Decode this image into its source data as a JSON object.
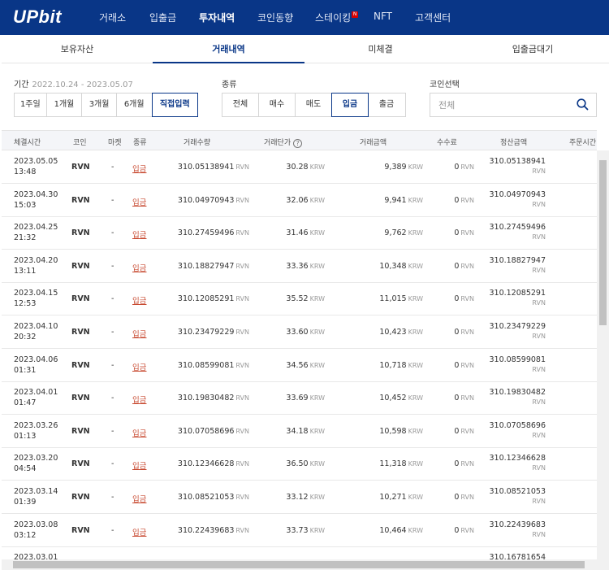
{
  "brand": {
    "logo": "UPbit"
  },
  "nav": {
    "items": [
      "거래소",
      "입출금",
      "투자내역",
      "코인동향",
      "스테이킹",
      "NFT",
      "고객센터"
    ],
    "active": "투자내역",
    "new_badge": "N",
    "colors": {
      "bar": "#093687",
      "badge": "#d60000"
    }
  },
  "subtabs": [
    "보유자산",
    "거래내역",
    "미체결",
    "입출금대기"
  ],
  "subtab_active": "거래내역",
  "filter": {
    "period_label": "기간",
    "date_range": "2022.10.24 - 2023.05.07",
    "periods": [
      "1주일",
      "1개월",
      "3개월",
      "6개월",
      "직접입력"
    ],
    "period_selected": "직접입력",
    "kind_label": "종류",
    "kinds": [
      "전체",
      "매수",
      "매도",
      "입금",
      "출금"
    ],
    "kind_selected": "입금",
    "coin_label": "코인선택",
    "search_placeholder": "전체",
    "search_icon": "search-icon"
  },
  "table": {
    "headers": [
      "체결시간",
      "코인",
      "마켓",
      "종류",
      "거래수량",
      "거래단가",
      "거래금액",
      "수수료",
      "정산금액",
      "주문시간"
    ],
    "help_mark": "?",
    "rows": [
      {
        "date": "2023.05.05",
        "time": "13:48",
        "coin": "RVN",
        "market": "-",
        "kind": "입금",
        "qty": "310.05138941",
        "qty_unit": "RVN",
        "price": "30.28",
        "price_unit": "KRW",
        "amount": "9,389",
        "amount_unit": "KRW",
        "fee": "0",
        "fee_unit": "RVN",
        "settle": "310.05138941",
        "settle_unit": "RVN",
        "order_time": "-"
      },
      {
        "date": "2023.04.30",
        "time": "15:03",
        "coin": "RVN",
        "market": "-",
        "kind": "입금",
        "qty": "310.04970943",
        "qty_unit": "RVN",
        "price": "32.06",
        "price_unit": "KRW",
        "amount": "9,941",
        "amount_unit": "KRW",
        "fee": "0",
        "fee_unit": "RVN",
        "settle": "310.04970943",
        "settle_unit": "RVN",
        "order_time": "-"
      },
      {
        "date": "2023.04.25",
        "time": "21:32",
        "coin": "RVN",
        "market": "-",
        "kind": "입금",
        "qty": "310.27459496",
        "qty_unit": "RVN",
        "price": "31.46",
        "price_unit": "KRW",
        "amount": "9,762",
        "amount_unit": "KRW",
        "fee": "0",
        "fee_unit": "RVN",
        "settle": "310.27459496",
        "settle_unit": "RVN",
        "order_time": "-"
      },
      {
        "date": "2023.04.20",
        "time": "13:11",
        "coin": "RVN",
        "market": "-",
        "kind": "입금",
        "qty": "310.18827947",
        "qty_unit": "RVN",
        "price": "33.36",
        "price_unit": "KRW",
        "amount": "10,348",
        "amount_unit": "KRW",
        "fee": "0",
        "fee_unit": "RVN",
        "settle": "310.18827947",
        "settle_unit": "RVN",
        "order_time": "-"
      },
      {
        "date": "2023.04.15",
        "time": "12:53",
        "coin": "RVN",
        "market": "-",
        "kind": "입금",
        "qty": "310.12085291",
        "qty_unit": "RVN",
        "price": "35.52",
        "price_unit": "KRW",
        "amount": "11,015",
        "amount_unit": "KRW",
        "fee": "0",
        "fee_unit": "RVN",
        "settle": "310.12085291",
        "settle_unit": "RVN",
        "order_time": "-"
      },
      {
        "date": "2023.04.10",
        "time": "20:32",
        "coin": "RVN",
        "market": "-",
        "kind": "입금",
        "qty": "310.23479229",
        "qty_unit": "RVN",
        "price": "33.60",
        "price_unit": "KRW",
        "amount": "10,423",
        "amount_unit": "KRW",
        "fee": "0",
        "fee_unit": "RVN",
        "settle": "310.23479229",
        "settle_unit": "RVN",
        "order_time": "-"
      },
      {
        "date": "2023.04.06",
        "time": "01:31",
        "coin": "RVN",
        "market": "-",
        "kind": "입금",
        "qty": "310.08599081",
        "qty_unit": "RVN",
        "price": "34.56",
        "price_unit": "KRW",
        "amount": "10,718",
        "amount_unit": "KRW",
        "fee": "0",
        "fee_unit": "RVN",
        "settle": "310.08599081",
        "settle_unit": "RVN",
        "order_time": "-"
      },
      {
        "date": "2023.04.01",
        "time": "01:47",
        "coin": "RVN",
        "market": "-",
        "kind": "입금",
        "qty": "310.19830482",
        "qty_unit": "RVN",
        "price": "33.69",
        "price_unit": "KRW",
        "amount": "10,452",
        "amount_unit": "KRW",
        "fee": "0",
        "fee_unit": "RVN",
        "settle": "310.19830482",
        "settle_unit": "RVN",
        "order_time": "-"
      },
      {
        "date": "2023.03.26",
        "time": "01:13",
        "coin": "RVN",
        "market": "-",
        "kind": "입금",
        "qty": "310.07058696",
        "qty_unit": "RVN",
        "price": "34.18",
        "price_unit": "KRW",
        "amount": "10,598",
        "amount_unit": "KRW",
        "fee": "0",
        "fee_unit": "RVN",
        "settle": "310.07058696",
        "settle_unit": "RVN",
        "order_time": "-"
      },
      {
        "date": "2023.03.20",
        "time": "04:54",
        "coin": "RVN",
        "market": "-",
        "kind": "입금",
        "qty": "310.12346628",
        "qty_unit": "RVN",
        "price": "36.50",
        "price_unit": "KRW",
        "amount": "11,318",
        "amount_unit": "KRW",
        "fee": "0",
        "fee_unit": "RVN",
        "settle": "310.12346628",
        "settle_unit": "RVN",
        "order_time": "-"
      },
      {
        "date": "2023.03.14",
        "time": "01:39",
        "coin": "RVN",
        "market": "-",
        "kind": "입금",
        "qty": "310.08521053",
        "qty_unit": "RVN",
        "price": "33.12",
        "price_unit": "KRW",
        "amount": "10,271",
        "amount_unit": "KRW",
        "fee": "0",
        "fee_unit": "RVN",
        "settle": "310.08521053",
        "settle_unit": "RVN",
        "order_time": "-"
      },
      {
        "date": "2023.03.08",
        "time": "03:12",
        "coin": "RVN",
        "market": "-",
        "kind": "입금",
        "qty": "310.22439683",
        "qty_unit": "RVN",
        "price": "33.73",
        "price_unit": "KRW",
        "amount": "10,464",
        "amount_unit": "KRW",
        "fee": "0",
        "fee_unit": "RVN",
        "settle": "310.22439683",
        "settle_unit": "RVN",
        "order_time": "-"
      },
      {
        "date": "2023.03.01",
        "time": "",
        "coin": "",
        "market": "",
        "kind": "",
        "qty": "",
        "qty_unit": "",
        "price": "",
        "price_unit": "",
        "amount": "",
        "amount_unit": "",
        "fee": "",
        "fee_unit": "",
        "settle": "310.16781654",
        "settle_unit": "",
        "order_time": ""
      }
    ]
  }
}
